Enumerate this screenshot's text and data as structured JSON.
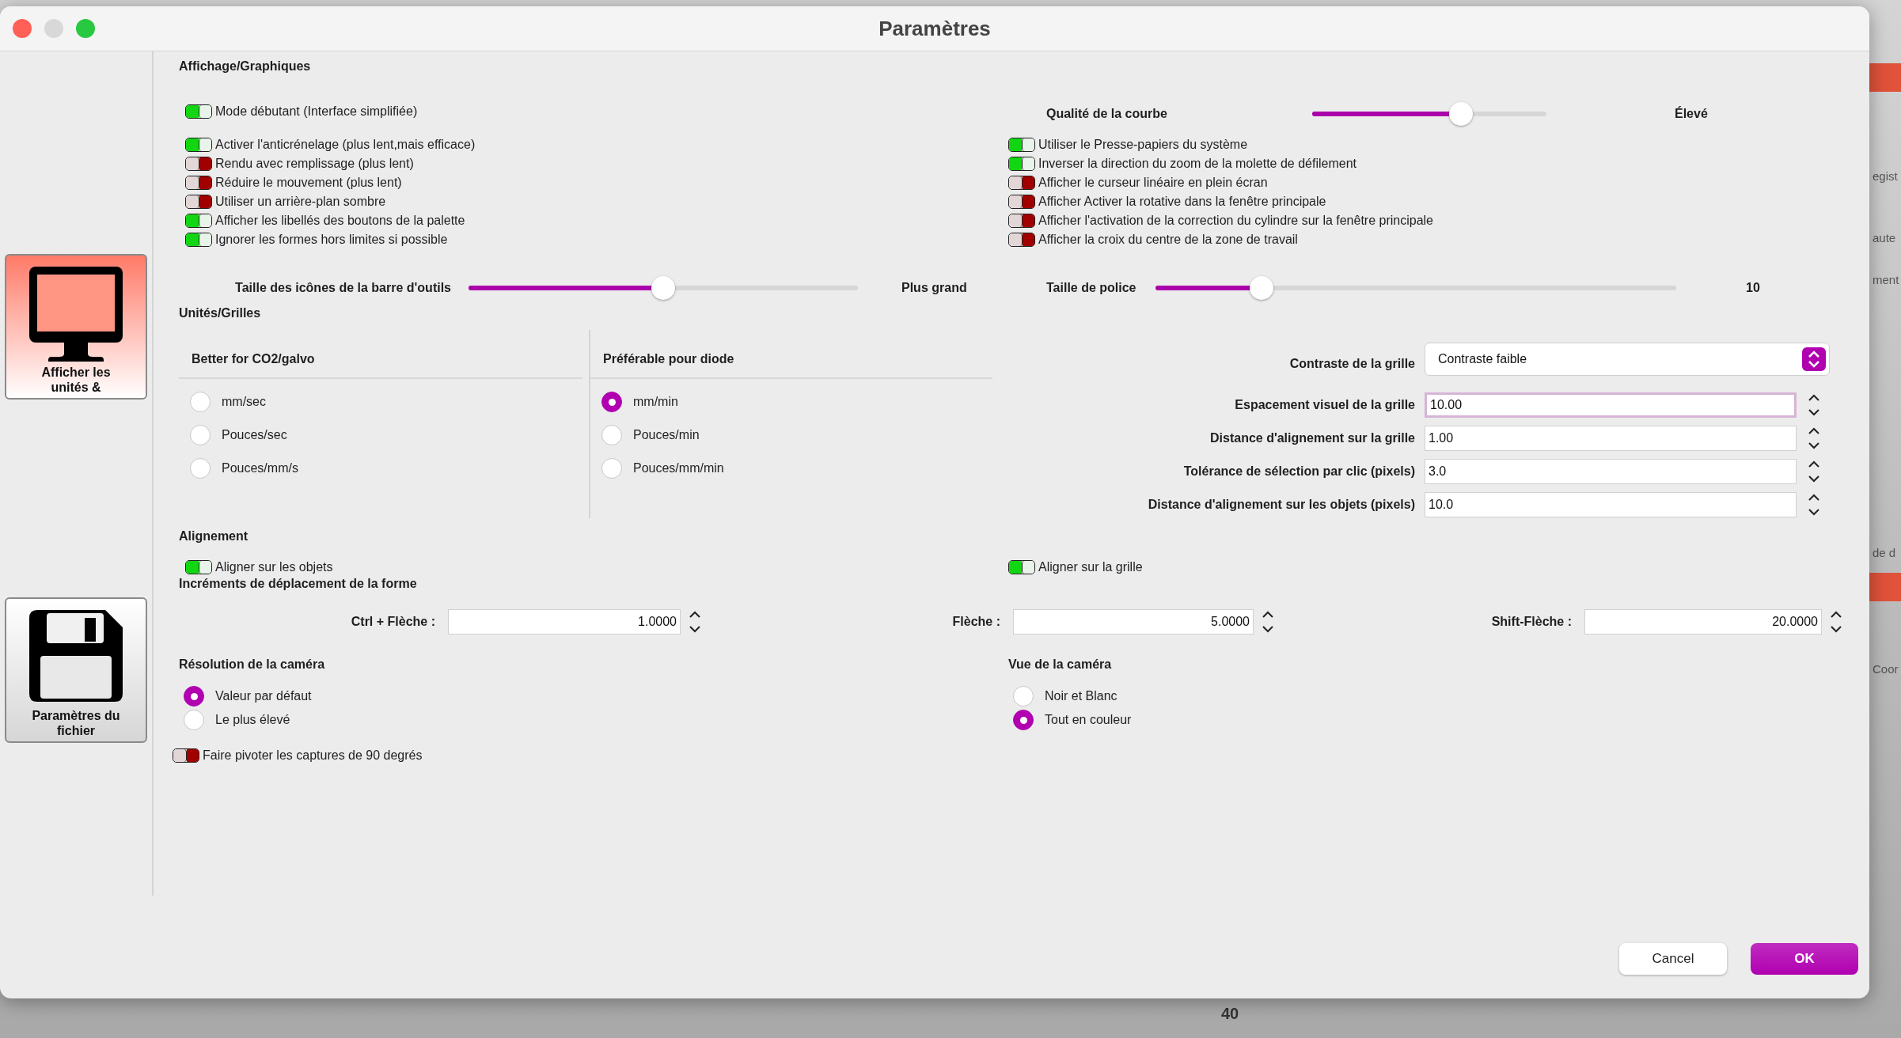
{
  "window": {
    "title": "Paramètres"
  },
  "sidebar": {
    "items": [
      {
        "label": "Afficher les unités &",
        "kind": "display",
        "selected": true
      },
      {
        "label": "Paramètres du fichier",
        "kind": "file",
        "selected": false
      }
    ]
  },
  "display": {
    "title": "Affichage/Graphiques",
    "beginner_toggle": {
      "label": "Mode débutant (Interface simplifiée)",
      "on": true
    },
    "curve_quality": {
      "label": "Qualité de la courbe",
      "level": 0.65,
      "value": "Élevé"
    },
    "left_toggles": [
      {
        "label": "Activer l'anticrénelage (plus lent,mais efficace)",
        "on": true
      },
      {
        "label": "Rendu avec remplissage (plus lent)",
        "on": false
      },
      {
        "label": "Réduire le mouvement (plus lent)",
        "on": false
      },
      {
        "label": "Utiliser un arrière-plan sombre",
        "on": false
      },
      {
        "label": "Afficher les libellés des boutons de la palette",
        "on": true
      },
      {
        "label": "Ignorer les formes hors limites si possible",
        "on": true
      }
    ],
    "right_toggles": [
      {
        "label": "Utiliser le Presse-papiers du système",
        "on": true
      },
      {
        "label": "Inverser la direction du zoom de la molette de défilement",
        "on": true
      },
      {
        "label": "Afficher le curseur linéaire en plein écran",
        "on": false
      },
      {
        "label": "Afficher Activer la rotative dans la fenêtre principale",
        "on": false
      },
      {
        "label": "Afficher l'activation de la correction du cylindre sur la fenêtre principale",
        "on": false
      },
      {
        "label": "Afficher la croix du centre de la zone de travail",
        "on": false
      }
    ],
    "icon_size": {
      "label": "Taille des icônes de la barre d'outils",
      "level": 0.5,
      "value": "Plus grand"
    },
    "font_size": {
      "label": "Taille de police",
      "level": 0.19,
      "value": "10"
    }
  },
  "units": {
    "title": "Unités/Grilles",
    "groups": [
      {
        "title": "Better for CO2/galvo",
        "options": [
          {
            "label": "mm/sec",
            "selected": false
          },
          {
            "label": "Pouces/sec",
            "selected": false
          },
          {
            "label": "Pouces/mm/s",
            "selected": false
          }
        ]
      },
      {
        "title": "Préférable pour diode",
        "options": [
          {
            "label": "mm/min",
            "selected": true
          },
          {
            "label": "Pouces/min",
            "selected": false
          },
          {
            "label": "Pouces/mm/min",
            "selected": false
          }
        ]
      }
    ],
    "grid_contrast": {
      "label": "Contraste de la grille",
      "value": "Contraste faible"
    },
    "fields": [
      {
        "label": "Espacement visuel de la grille",
        "value": "10.00",
        "focused": true
      },
      {
        "label": "Distance d'alignement sur la grille",
        "value": "1.00",
        "focused": false
      },
      {
        "label": "Tolérance de sélection par clic (pixels)",
        "value": "3.0",
        "focused": false
      },
      {
        "label": "Distance d'alignement sur les objets (pixels)",
        "value": "10.0",
        "focused": false
      }
    ]
  },
  "alignment": {
    "title": "Alignement",
    "toggles": [
      {
        "label": "Aligner sur les objets",
        "on": true
      },
      {
        "label": "Aligner sur la grille",
        "on": true
      }
    ],
    "increments_title": "Incréments de déplacement de la forme",
    "increments": [
      {
        "label": "Ctrl + Flèche :",
        "value": "1.0000"
      },
      {
        "label": "Flèche :",
        "value": "5.0000"
      },
      {
        "label": "Shift-Flèche :",
        "value": "20.0000"
      }
    ]
  },
  "camera": {
    "resolution": {
      "title": "Résolution de la caméra",
      "options": [
        {
          "label": "Valeur par défaut",
          "selected": true
        },
        {
          "label": "Le plus élevé",
          "selected": false
        }
      ]
    },
    "view": {
      "title": "Vue de la caméra",
      "options": [
        {
          "label": "Noir et Blanc",
          "selected": false
        },
        {
          "label": "Tout en couleur",
          "selected": true
        }
      ]
    },
    "rotate_toggle": {
      "label": "Faire pivoter les captures de 90 degrés",
      "on": false
    }
  },
  "buttons": [
    {
      "label": "Cancel",
      "kind": "secondary"
    },
    {
      "label": "OK",
      "kind": "primary"
    }
  ],
  "backdrop": {
    "fragments": [
      "egist",
      "aute",
      "ment",
      "de d",
      "Coor",
      "40"
    ]
  }
}
